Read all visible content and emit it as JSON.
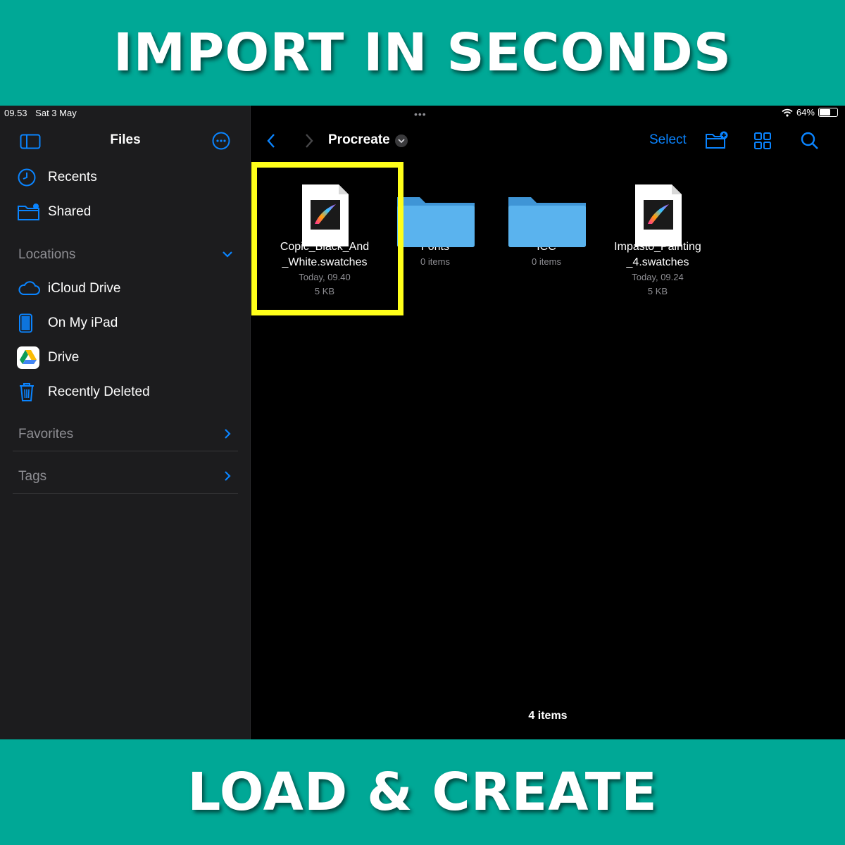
{
  "banners": {
    "top": "IMPORT IN SECONDS",
    "bottom": "LOAD & CREATE"
  },
  "status_bar": {
    "time": "09.53",
    "date": "Sat 3 May",
    "battery": "64%",
    "battery_level": 0.64
  },
  "sidebar": {
    "title": "Files",
    "top_items": [
      {
        "label": "Recents",
        "icon": "clock-icon"
      },
      {
        "label": "Shared",
        "icon": "shared-folder-icon"
      }
    ],
    "locations": {
      "label": "Locations",
      "items": [
        {
          "label": "iCloud Drive",
          "icon": "icloud-icon"
        },
        {
          "label": "On My iPad",
          "icon": "ipad-icon"
        },
        {
          "label": "Drive",
          "icon": "google-drive-icon"
        },
        {
          "label": "Recently Deleted",
          "icon": "trash-icon"
        }
      ]
    },
    "favorites": {
      "label": "Favorites"
    },
    "tags": {
      "label": "Tags"
    }
  },
  "toolbar": {
    "folder_title": "Procreate",
    "select_label": "Select"
  },
  "files": [
    {
      "name_line1": "Copic_Black_And",
      "name_line2": "_White.swatches",
      "date": "Today, 09.40",
      "size": "5 KB",
      "kind": "swatches"
    },
    {
      "name_line1": "Fonts",
      "name_line2": "",
      "meta": "0 items",
      "kind": "folder"
    },
    {
      "name_line1": "ICC",
      "name_line2": "",
      "meta": "0 items",
      "kind": "folder"
    },
    {
      "name_line1": "Impasto_Painting",
      "name_line2": "_4.swatches",
      "date": "Today, 09.24",
      "size": "5 KB",
      "kind": "swatches"
    }
  ],
  "footer": {
    "item_count": "4 items"
  },
  "colors": {
    "accent": "#0a84ff",
    "banner": "#00a896",
    "highlight": "#ffff1a",
    "sidebar_bg": "#1c1c1e",
    "folder": "#5ab3ee"
  }
}
